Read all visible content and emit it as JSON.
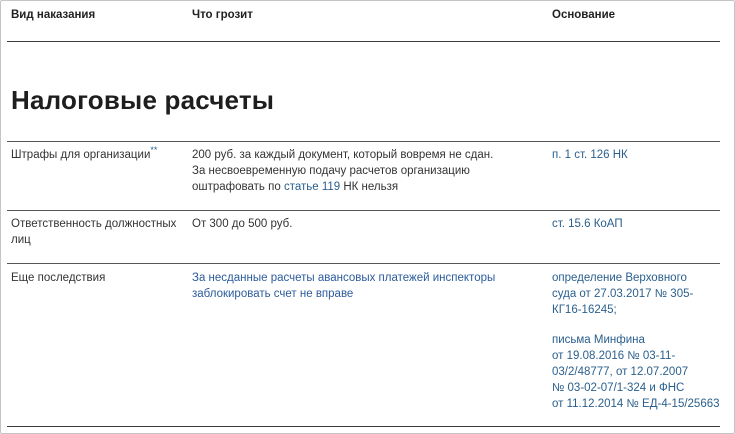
{
  "table": {
    "headers": [
      "Вид наказания",
      "Что грозит",
      "Основание"
    ],
    "section_title": "Налоговые расчеты",
    "rows": [
      {
        "type": "Штрафы для организации",
        "type_mark": "**",
        "threat_line1": "200 руб. за каждый документ, который вовремя не сдан.",
        "threat_line2": "За несвоевременную подачу расчетов организацию",
        "threat_line3_pre": "оштрафовать по ",
        "threat_line3_link": "статье 119",
        "threat_line3_post": " НК нельзя",
        "basis": "п. 1 ст. 126 НК"
      },
      {
        "type_line1": "Ответственность должностных",
        "type_line2": "лиц",
        "threat": "От 300 до 500 руб.",
        "basis": "ст. 15.6 КоАП"
      },
      {
        "type": "Еще последствия",
        "threat_line1": "За несданные расчеты авансовых платежей инспекторы",
        "threat_line2": "заблокировать счет не вправе",
        "basis_a_line1": "определение Верховного",
        "basis_a_line2": "суда от 27.03.2017 № 305-",
        "basis_a_line3": "КГ16-16245;",
        "basis_b_line1": "письма Минфина",
        "basis_b_line2": "от 19.08.2016 № 03-11-",
        "basis_b_line3": "03/2/48777, от 12.07.2007",
        "basis_b_line4": "№ 03-02-07/1-324 и ФНС",
        "basis_b_line5": "от 11.12.2014 № ЕД-4-15/25663"
      }
    ]
  }
}
